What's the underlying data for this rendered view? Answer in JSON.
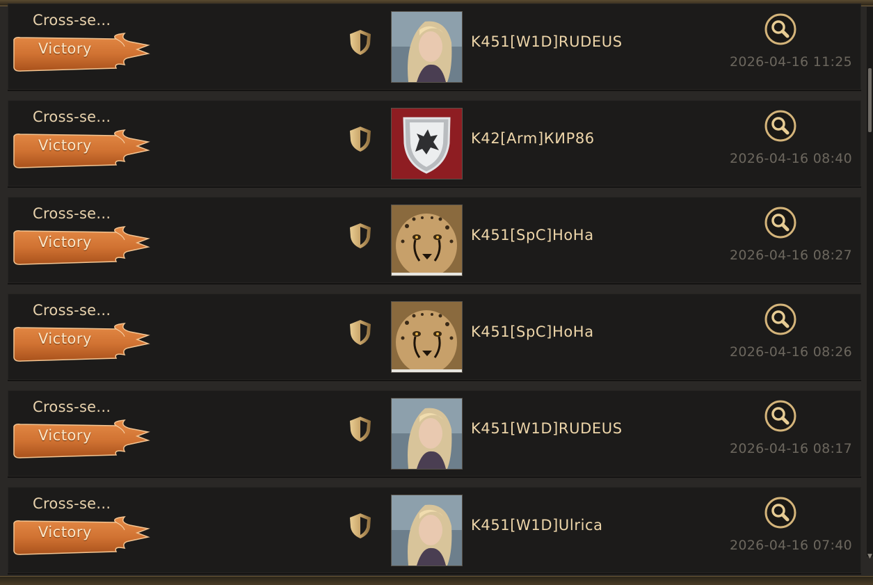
{
  "rows": [
    {
      "type": "Cross-se...",
      "result": "Victory",
      "player": "K451[W1D]RUDEUS",
      "avatar": "woman-portrait",
      "time": "2026-04-16 11:25"
    },
    {
      "type": "Cross-se...",
      "result": "Victory",
      "player": "K42[Arm]КИР86",
      "avatar": "wolf-sigil-shield",
      "time": "2026-04-16 08:40"
    },
    {
      "type": "Cross-se...",
      "result": "Victory",
      "player": "K451[SpC]HoHa",
      "avatar": "cheetah-portrait",
      "time": "2026-04-16 08:27"
    },
    {
      "type": "Cross-se...",
      "result": "Victory",
      "player": "K451[SpC]HoHa",
      "avatar": "cheetah-portrait",
      "time": "2026-04-16 08:26"
    },
    {
      "type": "Cross-se...",
      "result": "Victory",
      "player": "K451[W1D]RUDEUS",
      "avatar": "woman-portrait",
      "time": "2026-04-16 08:17"
    },
    {
      "type": "Cross-se...",
      "result": "Victory",
      "player": "K451[W1D]Ulrica",
      "avatar": "woman-portrait",
      "time": "2026-04-16 07:40"
    }
  ],
  "icons": {
    "row_icon": "shield-icon",
    "action_icon": "magnifier-icon"
  },
  "colors": {
    "banner": "#d9783a",
    "gold": "#c9a56a",
    "text": "#eed6aa",
    "timestamp": "#6c675e"
  }
}
